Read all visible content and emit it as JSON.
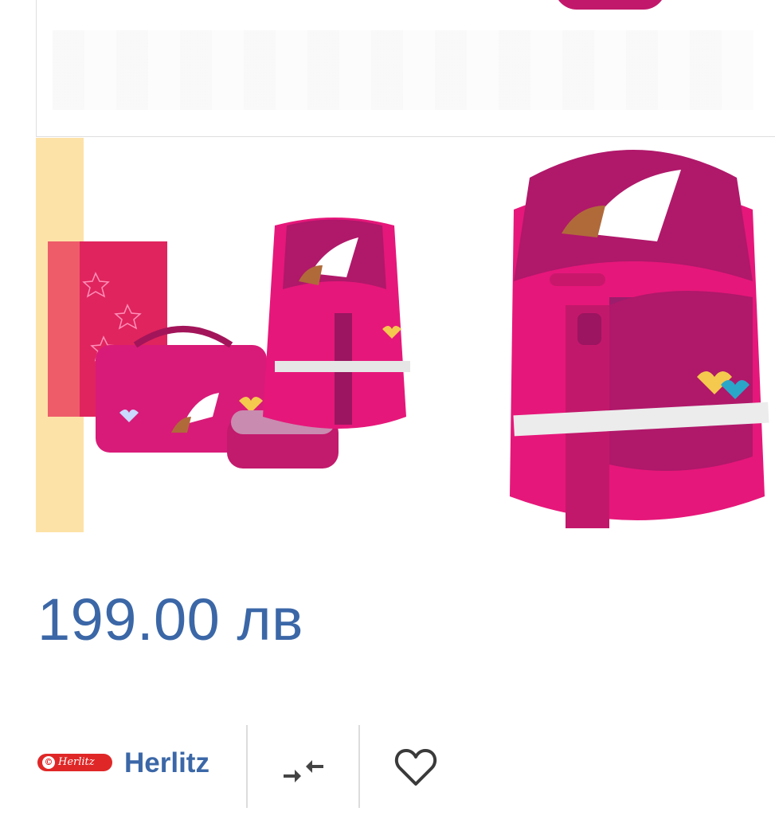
{
  "gallery": {
    "prev_arrow": "‹"
  },
  "product": {
    "price": "199.00 лв"
  },
  "brand": {
    "logo_text": "Herlitz",
    "name": "Herlitz"
  },
  "icons": {
    "prev": "chevron-left-icon",
    "compare": "compare-arrows-icon",
    "wishlist": "heart-outline-icon"
  },
  "colors": {
    "price": "#3b67a7",
    "brand_logo": "#e02727",
    "thumb_indicator": "#fde2a7",
    "backpack_pink": "#e6177a",
    "backpack_magenta": "#b0186a"
  }
}
